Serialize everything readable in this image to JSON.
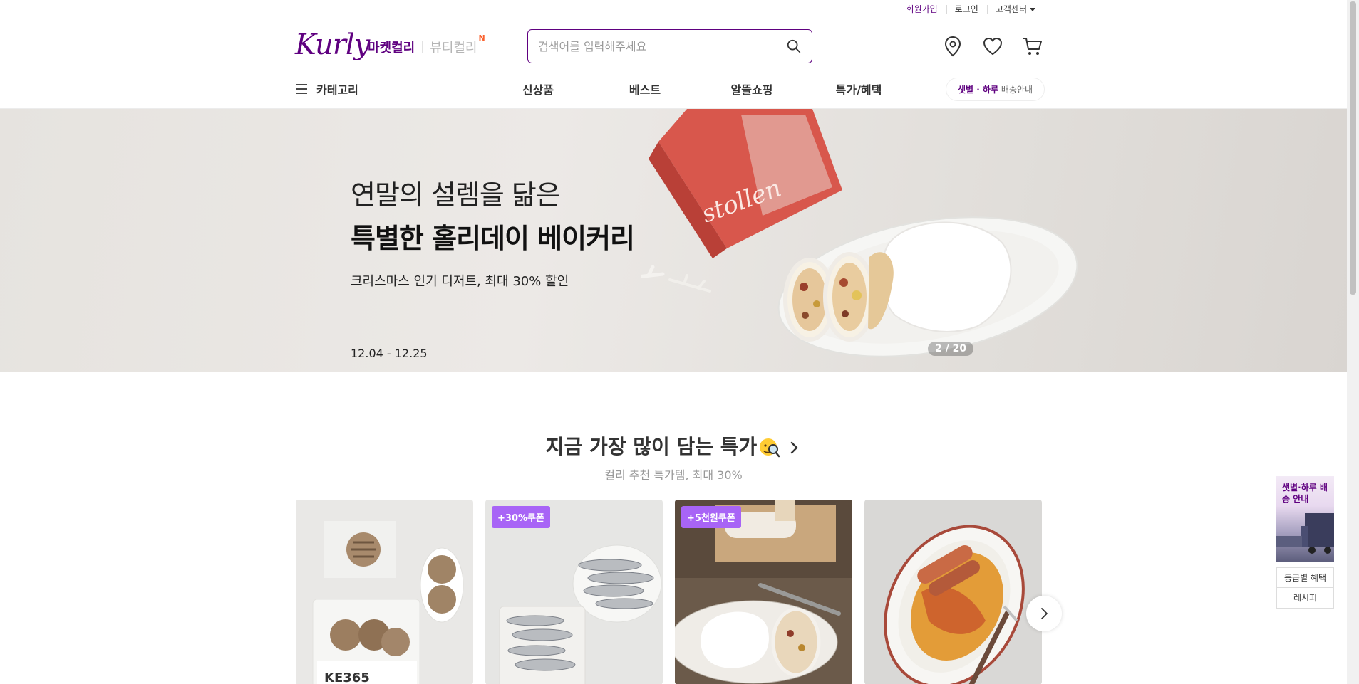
{
  "top_utility": {
    "signup": "회원가입",
    "login": "로그인",
    "customer_center": "고객센터"
  },
  "header": {
    "logo": "Kurly",
    "market_tab": "마켓컬리",
    "beauty_tab": "뷰티컬리",
    "beauty_badge": "N",
    "search_placeholder": "검색어를 입력해주세요",
    "icons": [
      "location-icon",
      "heart-icon",
      "cart-icon"
    ]
  },
  "gnb": {
    "category": "카테고리",
    "menu": [
      "신상품",
      "베스트",
      "알뜰쇼핑",
      "특가/혜택"
    ],
    "delivery_accent": "샛별 · 하루",
    "delivery_rest": " 배송안내"
  },
  "banner": {
    "line1": "연말의 설렘을 닮은",
    "line2": "특별한 홀리데이 베이커리",
    "sub": "크리스마스 인기 디저트, 최대 30% 할인",
    "date": "12.04 - 12.25",
    "box_text": "stollen",
    "pager": "2 / 20"
  },
  "section": {
    "title": "지금 가장 많이 담는 특가",
    "subtitle": "컬리 추천 특가템, 최대 30%"
  },
  "products": [
    {
      "coupon": "",
      "label": "KE365"
    },
    {
      "coupon": "+30%쿠폰",
      "label": ""
    },
    {
      "coupon": "+5천원쿠폰",
      "label": ""
    },
    {
      "coupon": "",
      "label": ""
    }
  ],
  "side": {
    "banner_text": "샛별·하루 배송 안내",
    "links": [
      "등급별 혜택",
      "레시피"
    ]
  },
  "colors": {
    "brand": "#5f0080",
    "coupon": "#a864f6",
    "badge_new": "#fa622f"
  }
}
